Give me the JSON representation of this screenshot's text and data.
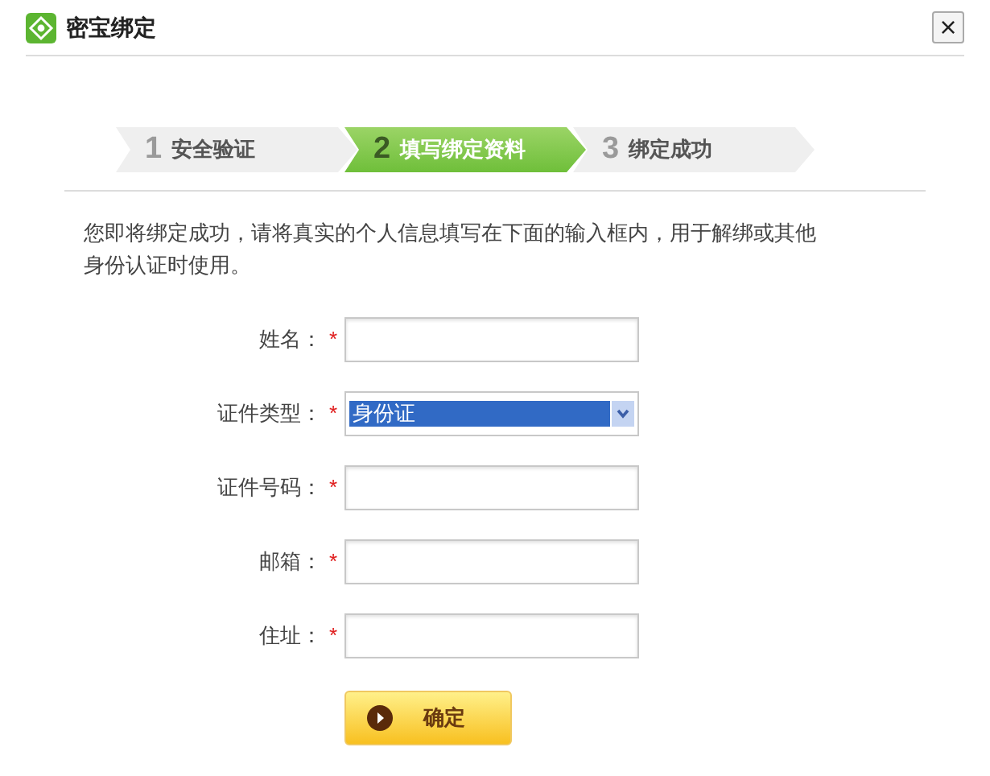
{
  "window": {
    "title": "密宝绑定",
    "close": "×"
  },
  "steps": [
    {
      "number": "1",
      "label": "安全验证",
      "selected": false
    },
    {
      "number": "2",
      "label": "填写绑定资料",
      "selected": true
    },
    {
      "number": "3",
      "label": "绑定成功",
      "selected": false
    }
  ],
  "intro": "您即将绑定成功，请将真实的个人信息填写在下面的输入框内，用于解绑或其他身份认证时使用。",
  "fields": [
    {
      "kind": "text",
      "label": "姓名：",
      "required": "*"
    },
    {
      "kind": "select",
      "label": "证件类型：",
      "required": "*",
      "value": "身份证"
    },
    {
      "kind": "text",
      "label": "证件号码：",
      "required": "*"
    },
    {
      "kind": "text",
      "label": "邮箱：",
      "required": "*"
    },
    {
      "kind": "text",
      "label": "住址：",
      "required": "*"
    }
  ],
  "submit": "确定"
}
